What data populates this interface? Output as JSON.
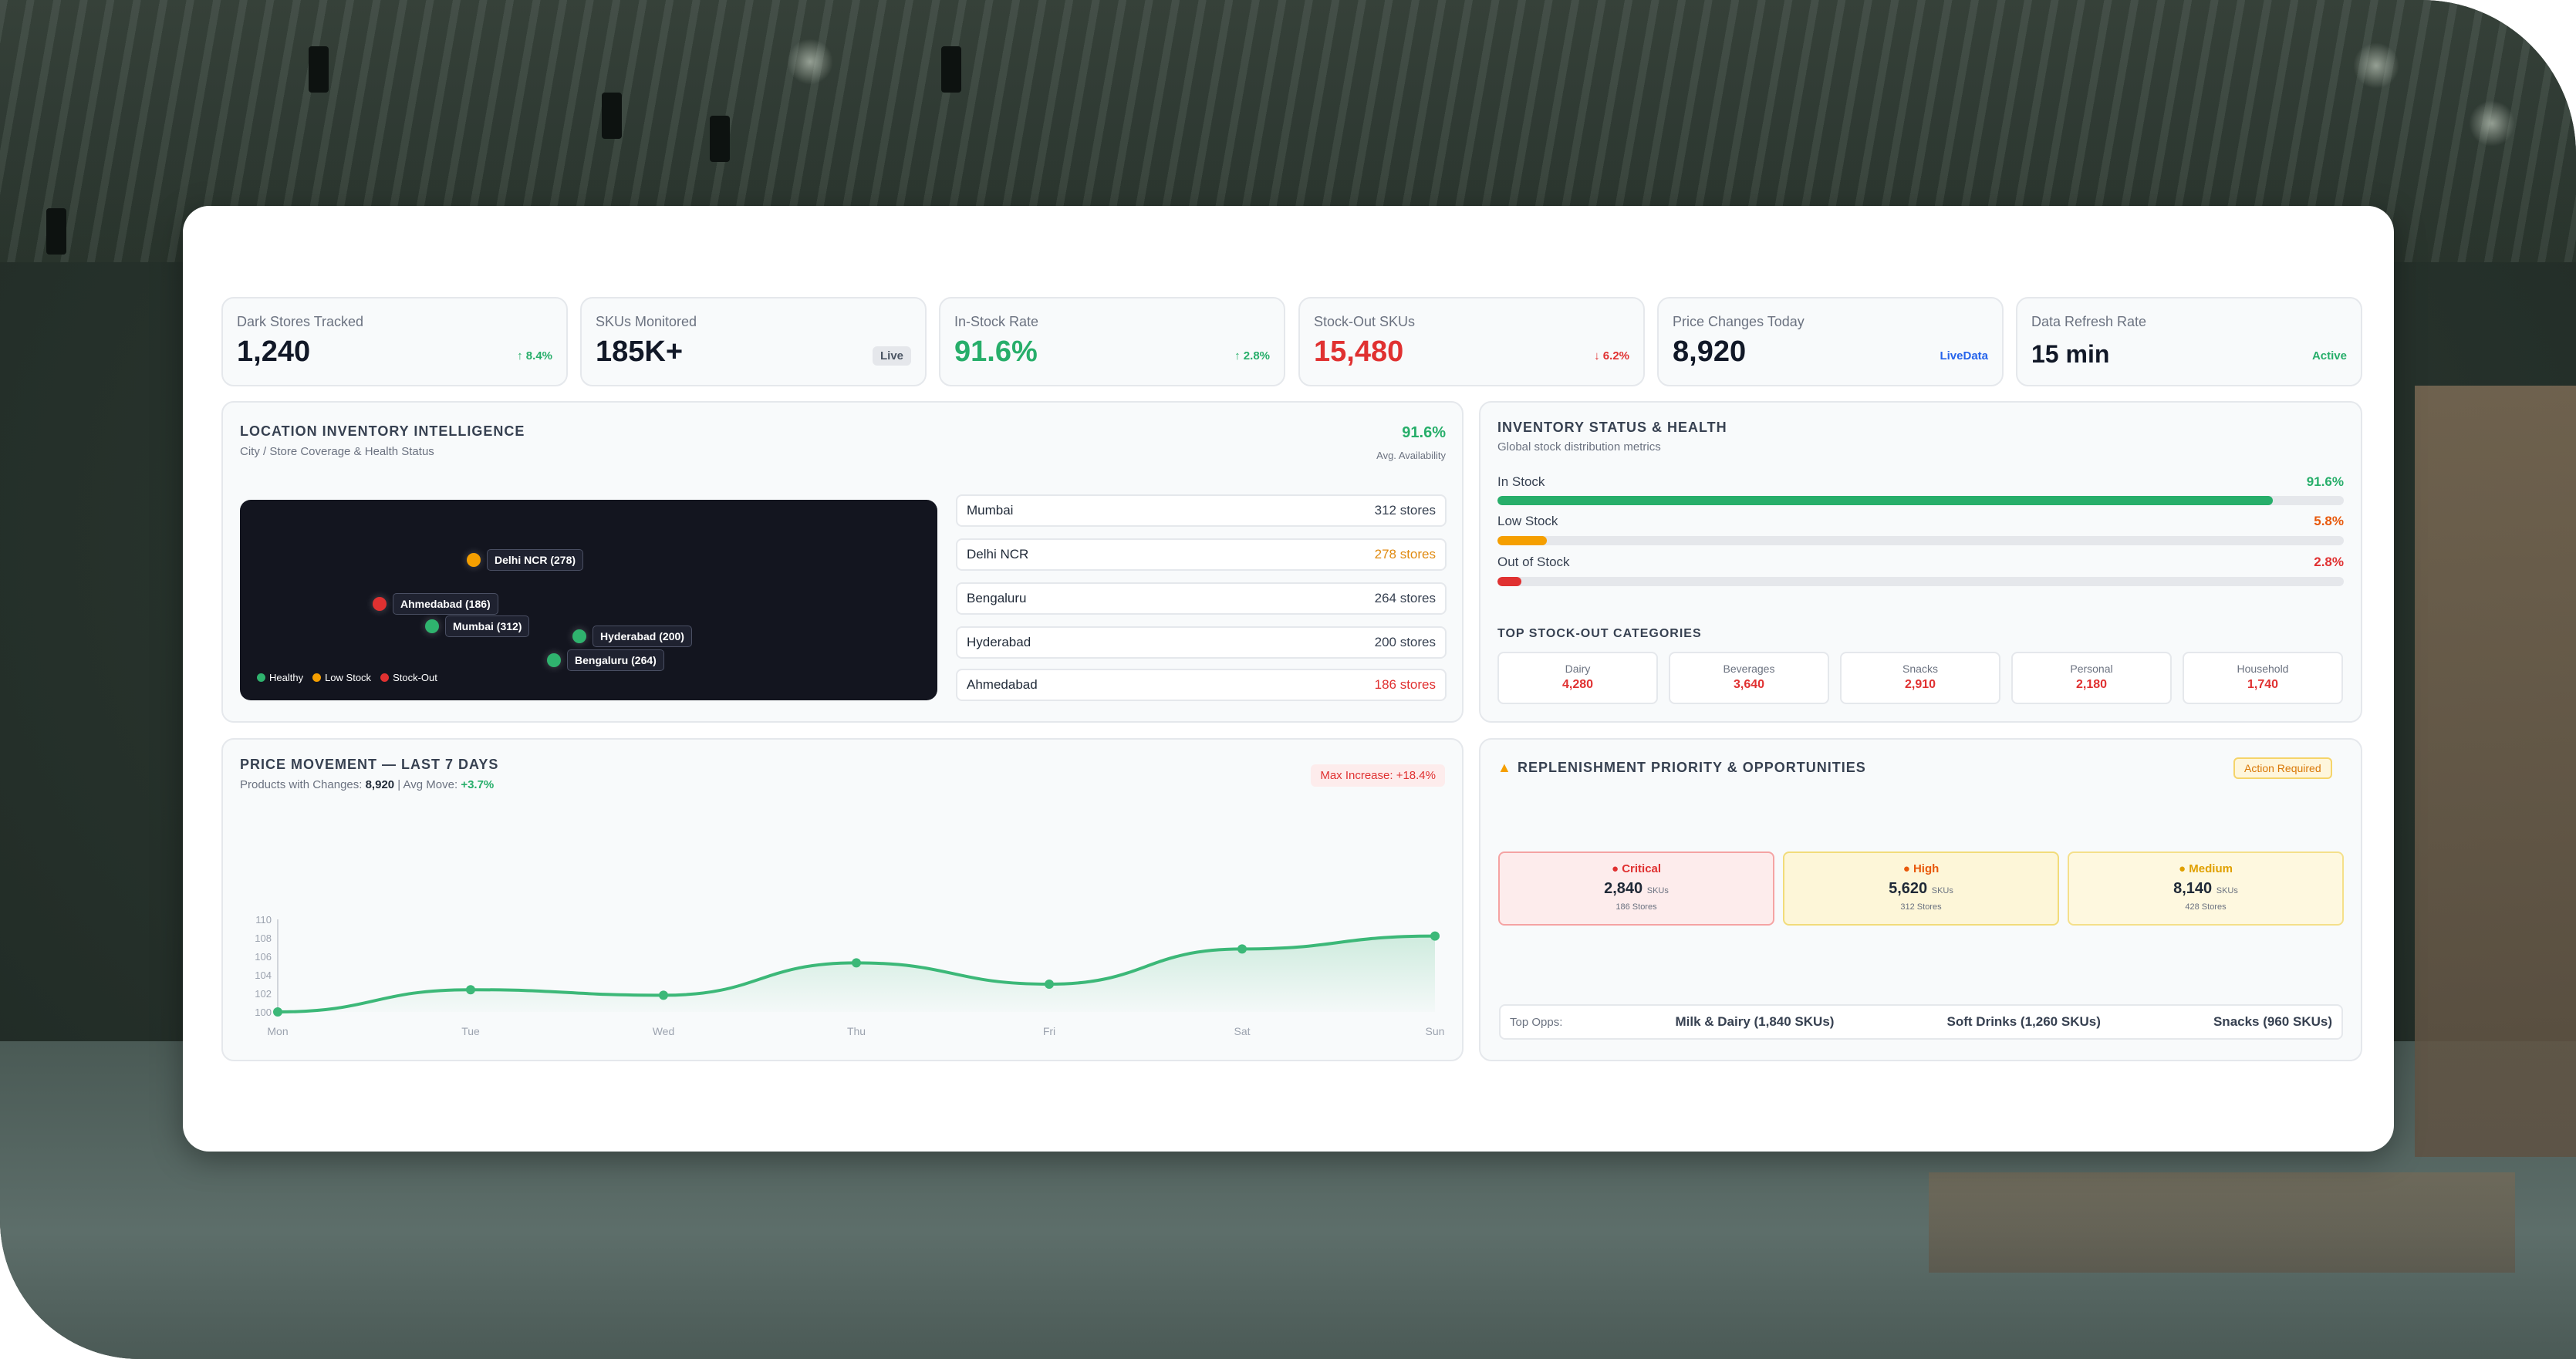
{
  "kpis": [
    {
      "label": "Dark Stores Tracked",
      "value": "1,240",
      "chip": "↑ 8.4%",
      "chip_tone": "up"
    },
    {
      "label": "SKUs Monitored",
      "value": "185K+",
      "chip": "Live",
      "chip_tone": "live"
    },
    {
      "label": "In-Stock Rate",
      "value": "91.6%",
      "chip": "↑ 2.8%",
      "chip_tone": "up",
      "value_color": "#27ae6a"
    },
    {
      "label": "Stock-Out SKUs",
      "value": "15,480",
      "chip": "↓ 6.2%",
      "chip_tone": "down",
      "value_color": "#e03131"
    },
    {
      "label": "Price Changes Today",
      "value": "8,920",
      "chip": "LiveData",
      "chip_tone": "livedata"
    },
    {
      "label": "Data Refresh Rate",
      "value": "15 min",
      "chip": "Active",
      "chip_tone": "active"
    }
  ],
  "location": {
    "title": "LOCATION INVENTORY INTELLIGENCE",
    "subtitle": "City / Store Coverage & Health Status",
    "avail_value": "91.6%",
    "avail_label": "Avg. Availability",
    "pins": [
      {
        "label": "Delhi NCR (278)",
        "status": "low"
      },
      {
        "label": "Ahmedabad (186)",
        "status": "out"
      },
      {
        "label": "Mumbai (312)",
        "status": "healthy"
      },
      {
        "label": "Hyderabad (200)",
        "status": "healthy"
      },
      {
        "label": "Bengaluru (264)",
        "status": "healthy"
      }
    ],
    "legend": {
      "healthy": "Healthy",
      "low": "Low Stock",
      "out": "Stock-Out"
    },
    "cities": [
      {
        "name": "Mumbai",
        "stores": "312 stores",
        "color": "#374151"
      },
      {
        "name": "Delhi NCR",
        "stores": "278 stores",
        "color": "#e08a10"
      },
      {
        "name": "Bengaluru",
        "stores": "264 stores",
        "color": "#374151"
      },
      {
        "name": "Hyderabad",
        "stores": "200 stores",
        "color": "#374151"
      },
      {
        "name": "Ahmedabad",
        "stores": "186 stores",
        "color": "#e03131"
      }
    ]
  },
  "inventory": {
    "title": "INVENTORY STATUS & HEALTH",
    "subtitle": "Global stock distribution metrics",
    "bars": [
      {
        "label": "In Stock",
        "pct": "91.6%",
        "value": 91.6,
        "color": "#27ae6a"
      },
      {
        "label": "Low Stock",
        "pct": "5.8%",
        "value": 5.8,
        "color": "#f59f00"
      },
      {
        "label": "Out of Stock",
        "pct": "2.8%",
        "value": 2.8,
        "color": "#e03131"
      }
    ],
    "categories_title": "TOP STOCK-OUT CATEGORIES",
    "categories": [
      {
        "name": "Dairy",
        "value": "4,280"
      },
      {
        "name": "Beverages",
        "value": "3,640"
      },
      {
        "name": "Snacks",
        "value": "2,910"
      },
      {
        "name": "Personal",
        "value": "2,180"
      },
      {
        "name": "Household",
        "value": "1,740"
      }
    ]
  },
  "price": {
    "title": "PRICE MOVEMENT — LAST 7 DAYS",
    "sub_prefix": "Products with Changes: ",
    "sub_count": "8,920",
    "sub_mid": " | Avg Move: ",
    "sub_move": "+3.7%",
    "badge": "Max Increase: +18.4%"
  },
  "chart_data": {
    "type": "line",
    "categories": [
      "Mon",
      "Tue",
      "Wed",
      "Thu",
      "Fri",
      "Sat",
      "Sun"
    ],
    "series": [
      {
        "values": [
          100.0,
          102.4,
          101.8,
          105.3,
          103.0,
          106.8,
          108.2
        ]
      }
    ],
    "ylim": [
      100,
      110
    ],
    "yticks": [
      "100",
      "102",
      "104",
      "106",
      "108",
      "110"
    ],
    "color": "#3cb878",
    "grid": false
  },
  "replenish": {
    "title": "REPLENISHMENT PRIORITY & OPPORTUNITIES",
    "badge": "Action Required",
    "priorities": [
      {
        "name": "Critical",
        "count": "2,840",
        "unit": "SKUs",
        "stores": "186 Stores",
        "color": "#e03131",
        "bg": "#fdecec",
        "border": "#f5a3a3"
      },
      {
        "name": "High",
        "count": "5,620",
        "unit": "SKUs",
        "stores": "312 Stores",
        "color": "#e8590c",
        "bg": "#fdf6d8",
        "border": "#f2dc7a"
      },
      {
        "name": "Medium",
        "count": "8,140",
        "unit": "SKUs",
        "stores": "428 Stores",
        "color": "#e0a000",
        "bg": "#fef8df",
        "border": "#f5e08a"
      }
    ],
    "opps_label": "Top Opps:",
    "opps": [
      "Milk & Dairy (1,840 SKUs)",
      "Soft Drinks (1,260 SKUs)",
      "Snacks (960 SKUs)"
    ]
  }
}
